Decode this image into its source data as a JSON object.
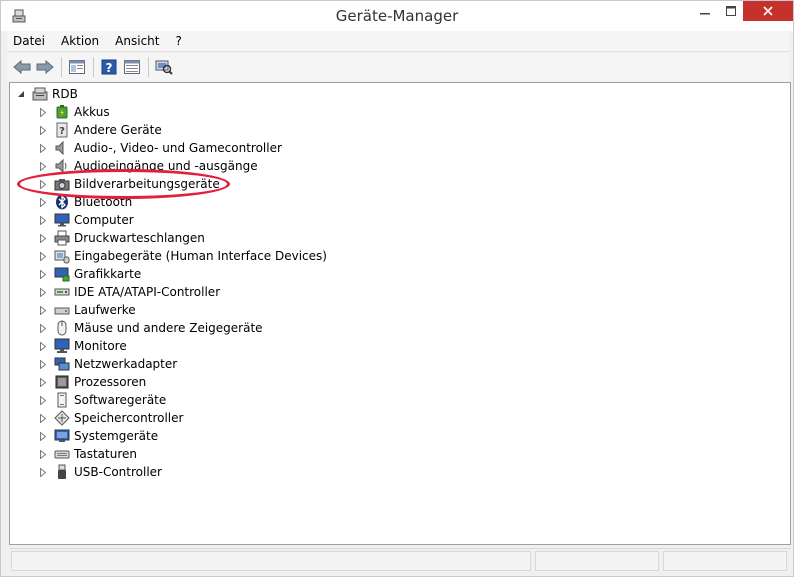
{
  "window": {
    "title": "Geräte-Manager"
  },
  "menu": {
    "items": [
      "Datei",
      "Aktion",
      "Ansicht",
      "?"
    ]
  },
  "toolbar": {
    "buttons": [
      "back-arrow-icon",
      "forward-arrow-icon",
      "properties-icon",
      "help-icon",
      "view-icon",
      "scan-hardware-icon"
    ]
  },
  "tree": {
    "root": "RDB",
    "items": [
      "Akkus",
      "Andere Geräte",
      "Audio-, Video- und Gamecontroller",
      "Audioeingänge und -ausgänge",
      "Bildverarbeitungsgeräte",
      "Bluetooth",
      "Computer",
      "Druckwarteschlangen",
      "Eingabegeräte (Human Interface Devices)",
      "Grafikkarte",
      "IDE ATA/ATAPI-Controller",
      "Laufwerke",
      "Mäuse und andere Zeigegeräte",
      "Monitore",
      "Netzwerkadapter",
      "Prozessoren",
      "Softwaregeräte",
      "Speichercontroller",
      "Systemgeräte",
      "Tastaturen",
      "USB-Controller"
    ],
    "highlighted": "Bildverarbeitungsgeräte"
  },
  "colors": {
    "highlight": "#e0203c",
    "close_button": "#c7312b"
  }
}
